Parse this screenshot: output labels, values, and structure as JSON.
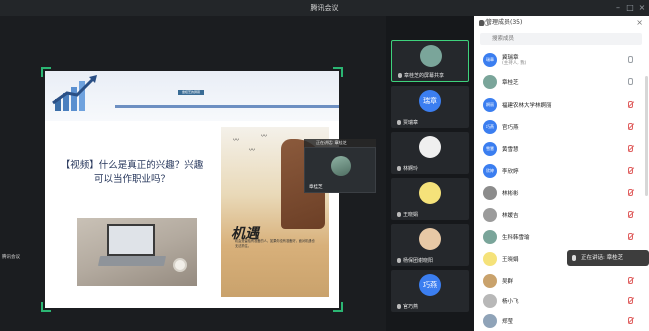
{
  "window": {
    "title": "腾讯会议"
  },
  "slide": {
    "title": "【视频】什么是真正的兴趣？兴趣可以当作职业吗？",
    "presenter_tag": "章桂芝的屏幕",
    "chance_word": "机遇",
    "chance_text": "机会是留给有准备的人，如果你没有准备好，面对机遇也无法抓住。"
  },
  "speaker_float": {
    "label": "正在讲话: 章桂芝",
    "name": "章桂芝"
  },
  "left_small": "腾讯会议",
  "video_tiles": [
    {
      "name": "章桂芝的屏幕共享",
      "avatar": "",
      "color": "#7aa59a"
    },
    {
      "name": "贾瑞章",
      "avatar": "瑞章",
      "color": "#3b7ef0"
    },
    {
      "name": "林婀玲",
      "avatar": "",
      "color": "#efefef"
    },
    {
      "name": "王晓娟",
      "avatar": "",
      "color": "#f5e27a"
    },
    {
      "name": "杨保团谢晓阳",
      "avatar": "",
      "color": "#e7c8a5"
    },
    {
      "name": "官巧燕",
      "avatar": "巧燕",
      "color": "#3b7ef0"
    }
  ],
  "members": {
    "header": "管理成员(35)",
    "search_placeholder": "搜索成员",
    "list": [
      {
        "name": "冀瑞章",
        "sub": "(主持人, 我)",
        "avatar": "瑞章",
        "color": "#3b7ef0",
        "muted": false
      },
      {
        "name": "章桂芝",
        "sub": "",
        "avatar": "",
        "color": "#7aa59a",
        "muted": false
      },
      {
        "name": "福建农林大学林婀丽",
        "sub": "",
        "avatar": "婀丽",
        "color": "#3b7ef0",
        "muted": true
      },
      {
        "name": "官巧燕",
        "sub": "",
        "avatar": "巧燕",
        "color": "#3b7ef0",
        "muted": true
      },
      {
        "name": "黄雪慧",
        "sub": "",
        "avatar": "雪慧",
        "color": "#3b7ef0",
        "muted": true
      },
      {
        "name": "李欣婷",
        "sub": "",
        "avatar": "欣婷",
        "color": "#3b7ef0",
        "muted": true
      },
      {
        "name": "林彬彬",
        "sub": "",
        "avatar": "",
        "color": "#8c8c8c",
        "muted": true
      },
      {
        "name": "林媛吉",
        "sub": "",
        "avatar": "",
        "color": "#9b9b9b",
        "muted": true
      },
      {
        "name": "生科韩雪瑜",
        "sub": "",
        "avatar": "",
        "color": "#7aa59a",
        "muted": true
      },
      {
        "name": "王晓娟",
        "sub": "",
        "avatar": "",
        "color": "#f5e27a",
        "muted": true
      },
      {
        "name": "吴群",
        "sub": "",
        "avatar": "",
        "color": "#c9a26c",
        "muted": true
      },
      {
        "name": "杨小飞",
        "sub": "",
        "avatar": "",
        "color": "#b8b8b8",
        "muted": true
      },
      {
        "name": "郑莹",
        "sub": "",
        "avatar": "",
        "color": "#8fa3b8",
        "muted": true
      }
    ]
  },
  "toast": {
    "label": "正在讲话: 章桂芝"
  }
}
